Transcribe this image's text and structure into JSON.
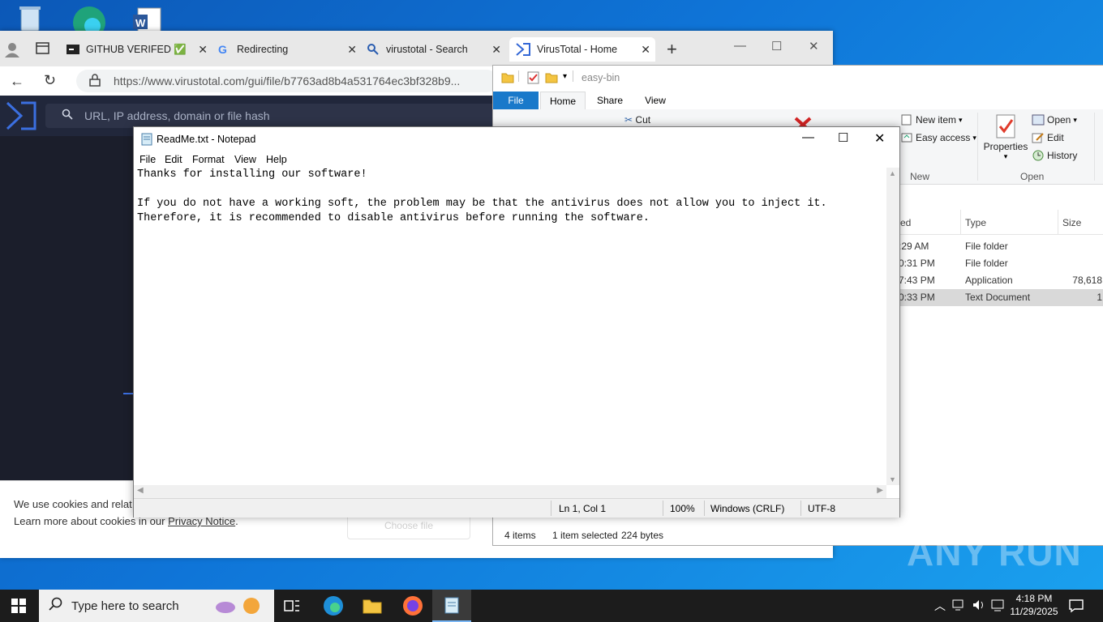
{
  "browser": {
    "tabs": [
      {
        "title": "GITHUB VERIFED ✅",
        "active": false
      },
      {
        "title": "Redirecting",
        "active": false
      },
      {
        "title": "virustotal - Search",
        "active": false
      },
      {
        "title": "VirusTotal - Home",
        "active": true
      }
    ],
    "url": "https://www.virustotal.com/gui/file/b7763ad8b4a531764ec3bf328b9...",
    "search_placeholder": "URL, IP address, domain or file hash",
    "cookie_line1": "We use cookies and relat",
    "cookie_line2_pre": "Learn more about cookies in our ",
    "cookie_link": "Privacy Notice",
    "cookie_line2_post": ".",
    "choose_file": "Choose file"
  },
  "explorer": {
    "path": "easy-bin",
    "tabs": [
      "File",
      "Home",
      "Share",
      "View"
    ],
    "ribbon": {
      "cut": "Cut",
      "new_item": "New item",
      "easy_access": "Easy access",
      "group_new": "New",
      "properties": "Properties",
      "open": "Open",
      "edit": "Edit",
      "history": "History",
      "group_open": "Open"
    },
    "columns": {
      "modified": "ed",
      "type": "Type",
      "size": "Size"
    },
    "rows": [
      {
        "time": ":29 AM",
        "type": "File folder",
        "size": ""
      },
      {
        "time": "0:31 PM",
        "type": "File folder",
        "size": ""
      },
      {
        "time": "7:43 PM",
        "type": "Application",
        "size": "78,618"
      },
      {
        "time": "0:33 PM",
        "type": "Text Document",
        "size": "1"
      }
    ],
    "status": {
      "items": "4 items",
      "selected": "1 item selected",
      "bytes": "224 bytes"
    }
  },
  "notepad": {
    "title": "ReadMe.txt - Notepad",
    "menu": [
      "File",
      "Edit",
      "Format",
      "View",
      "Help"
    ],
    "lines": [
      "Thanks for installing our software!",
      "",
      "If you do not have a working soft, the problem may be that the antivirus does not allow you to inject it.",
      "Therefore, it is recommended to disable antivirus before running the software."
    ],
    "status": {
      "position": "Ln 1, Col 1",
      "zoom": "100%",
      "eol": "Windows (CRLF)",
      "encoding": "UTF-8"
    }
  },
  "taskbar": {
    "search_placeholder": "Type here to search",
    "time": "4:18 PM",
    "date": "11/29/2025"
  },
  "watermark": "ANY RUN",
  "colors": {
    "vt_dark": "#21273b",
    "explorer_file_tab": "#1979ca",
    "taskbar": "#1c1c1c"
  }
}
